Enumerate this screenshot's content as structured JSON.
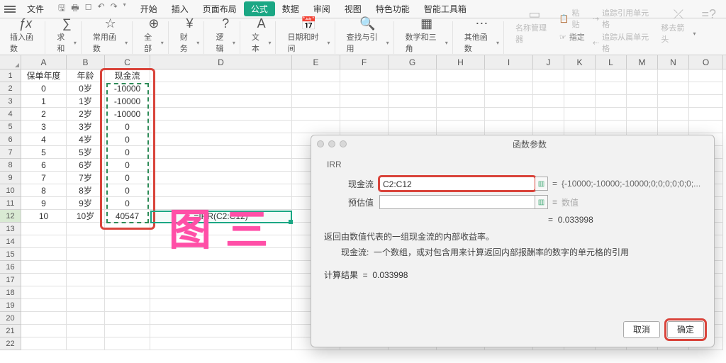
{
  "menubar": {
    "file": "文件",
    "tabs": [
      "开始",
      "插入",
      "页面布局",
      "公式",
      "数据",
      "审阅",
      "视图",
      "特色功能",
      "智能工具箱"
    ],
    "active_index": 3
  },
  "ribbon": {
    "insert_fn": "插入函数",
    "sum": "求和",
    "common": "常用函数",
    "all": "全部",
    "finance": "财务",
    "logic": "逻辑",
    "text": "文本",
    "datetime": "日期和时间",
    "lookup": "查找与引用",
    "math": "数学和三角",
    "other": "其他函数",
    "name_mgr": "名称管理器",
    "paste": "粘贴",
    "assign": "指定",
    "trace_prec": "追踪引用单元格",
    "trace_dep": "追踪从属单元格",
    "move_arrow": "移去箭头",
    "eqq": "=?"
  },
  "columns": [
    "A",
    "B",
    "C",
    "D",
    "E",
    "F",
    "G",
    "H",
    "I",
    "J",
    "K",
    "L",
    "M",
    "N",
    "O"
  ],
  "headers": {
    "A": "保单年度",
    "B": "年龄",
    "C": "现金流"
  },
  "rows": [
    {
      "n": 1,
      "A": "保单年度",
      "B": "年龄",
      "C": "现金流",
      "D": ""
    },
    {
      "n": 2,
      "A": "0",
      "B": "0岁",
      "C": "-10000",
      "D": ""
    },
    {
      "n": 3,
      "A": "1",
      "B": "1岁",
      "C": "-10000",
      "D": ""
    },
    {
      "n": 4,
      "A": "2",
      "B": "2岁",
      "C": "-10000",
      "D": ""
    },
    {
      "n": 5,
      "A": "3",
      "B": "3岁",
      "C": "0",
      "D": ""
    },
    {
      "n": 6,
      "A": "4",
      "B": "4岁",
      "C": "0",
      "D": ""
    },
    {
      "n": 7,
      "A": "5",
      "B": "5岁",
      "C": "0",
      "D": ""
    },
    {
      "n": 8,
      "A": "6",
      "B": "6岁",
      "C": "0",
      "D": ""
    },
    {
      "n": 9,
      "A": "7",
      "B": "7岁",
      "C": "0",
      "D": ""
    },
    {
      "n": 10,
      "A": "8",
      "B": "8岁",
      "C": "0",
      "D": ""
    },
    {
      "n": 11,
      "A": "9",
      "B": "9岁",
      "C": "0",
      "D": ""
    },
    {
      "n": 12,
      "A": "10",
      "B": "10岁",
      "C": "40547",
      "D": "=IRR(C2:C12)"
    }
  ],
  "extra_rows": [
    13,
    14,
    15,
    16,
    17,
    18,
    19,
    20,
    21,
    22
  ],
  "watermark": "图三",
  "dialog": {
    "title": "函数参数",
    "fn": "IRR",
    "param1_label": "现金流",
    "param1_value": "C2:C12",
    "param1_eval": "{-10000;-10000;-10000;0;0;0;0;0;0;...",
    "param2_label": "预估值",
    "param2_value": "",
    "param2_eval": "数值",
    "eq": "=",
    "result": "0.033998",
    "desc1": "返回由数值代表的一组现金流的内部收益率。",
    "desc2_label": "现金流:",
    "desc2_text": "一个数组，或对包含用来计算返回内部报酬率的数字的单元格的引用",
    "calc_label": "计算结果",
    "calc_value": "0.033998",
    "cancel": "取消",
    "ok": "确定"
  }
}
